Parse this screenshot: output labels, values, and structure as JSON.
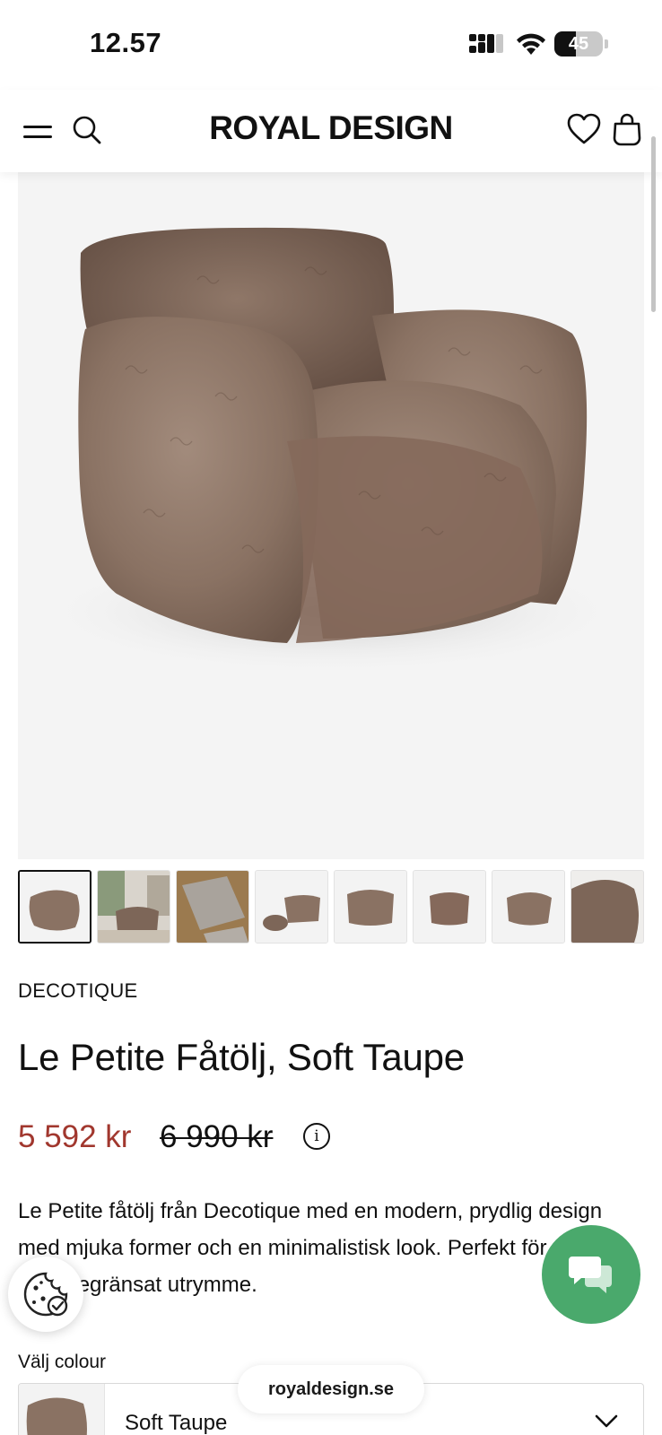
{
  "status_bar": {
    "time": "12.57",
    "battery_level": 45,
    "battery_text": "45"
  },
  "header": {
    "logo": "ROYAL DESIGN",
    "icons": [
      "menu-icon",
      "search-icon",
      "heart-icon",
      "shopping-bag-icon"
    ]
  },
  "gallery": {
    "main_image": "Le Petite armchair in fluffy taupe sheepskin",
    "thumbnail_count": 8,
    "selected_index": 0
  },
  "product": {
    "brand": "DECOTIQUE",
    "title": "Le Petite Fåtölj, Soft Taupe",
    "price": "5 592 kr",
    "old_price": "6 990 kr",
    "info_icon": "i",
    "description": "Le Petite fåtölj från Decotique med en modern, prydlig design med mjuka former och en minimalistisk look. Perfekt för platser med begränsat utrymme."
  },
  "variant": {
    "label": "Välj colour",
    "selected": "Soft Taupe"
  },
  "browser": {
    "url": "royaldesign.se"
  },
  "colors": {
    "price_red": "#a1372e",
    "chat_green": "#4aa96c",
    "chair_taupe": "#8a7263"
  }
}
